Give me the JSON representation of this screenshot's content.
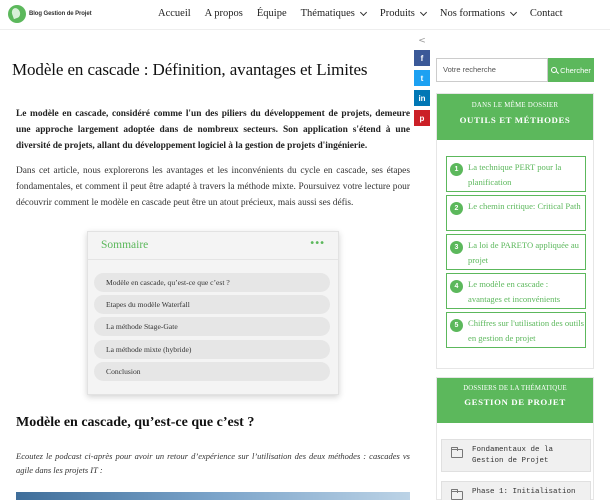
{
  "header": {
    "logo_text": "Blog Gestion de Projet",
    "nav": [
      {
        "label": "Accueil",
        "dropdown": false
      },
      {
        "label": "A propos",
        "dropdown": false
      },
      {
        "label": "Équipe",
        "dropdown": false
      },
      {
        "label": "Thématiques",
        "dropdown": true
      },
      {
        "label": "Produits",
        "dropdown": true
      },
      {
        "label": "Nos formations",
        "dropdown": true
      },
      {
        "label": "Contact",
        "dropdown": false
      }
    ]
  },
  "share": {
    "facebook": "f",
    "twitter": "t",
    "linkedin": "in",
    "pinterest": "p"
  },
  "article": {
    "title": "Modèle en cascade : Définition, avantages et Limites",
    "intro": "Le modèle en cascade, considéré comme l'un des piliers du développement de projets, demeure une approche largement adoptée dans de nombreux secteurs. Son application s'étend à une diversité de projets, allant du développement logiciel à la gestion de projets d'ingénierie.",
    "para": "Dans cet article, nous explorerons les avantages et les inconvénients du cycle en cascade, ses étapes fondamentales, et comment il peut être adapté à travers la méthode mixte. Poursuivez votre lecture pour découvrir comment le modèle en cascade peut être un atout précieux, mais aussi ses défis.",
    "h2": "Modèle en cascade, qu’est-ce que c’est ?",
    "podcast": "Ecoutez le podcast ci-après pour avoir un retour d’expérience sur l’utilisation des deux méthodes : cascades vs agile dans les projets IT :"
  },
  "toc": {
    "title": "Sommaire",
    "menu": "•••",
    "items": [
      "Modèle en cascade, qu’est-ce que c’est ?",
      "Etapes du modèle Waterfall",
      "La méthode Stage-Gate",
      "La méthode mixte (hybride)",
      "Conclusion"
    ]
  },
  "sidebar": {
    "search_placeholder": "Votre recherche",
    "search_button": "Chercher",
    "dossier": {
      "small": "DANS LE MÊME DOSSIER",
      "big": "OUTILS ET MÉTHODES",
      "items": [
        {
          "num": "1",
          "text": "La technique PERT pour la planification"
        },
        {
          "num": "2",
          "text": "Le chemin critique: Critical Path"
        },
        {
          "num": "3",
          "text": "La loi de PARETO appliquée au projet"
        },
        {
          "num": "4",
          "text": "Le modèle en cascade : avantages et inconvénients"
        },
        {
          "num": "5",
          "text": "Chiffres sur l'utilisation des outils en gestion de projet"
        }
      ]
    },
    "theme": {
      "small": "DOSSIERS DE LA THÉMATIQUE",
      "big": "GESTION DE PROJET",
      "items": [
        "Fondamentaux de la Gestion de Projet",
        "Phase 1: Initialisation"
      ]
    }
  },
  "colors": {
    "accent": "#5cb85c",
    "facebook": "#3b5998",
    "twitter": "#1da1f2",
    "linkedin": "#0077b5",
    "pinterest": "#cb2027"
  }
}
